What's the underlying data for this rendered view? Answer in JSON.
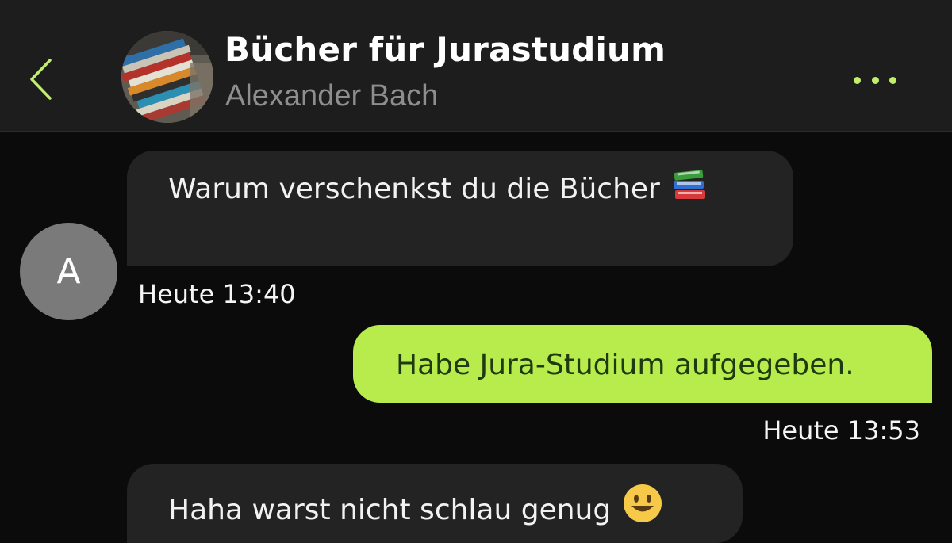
{
  "header": {
    "title": "Bücher für Jurastudium",
    "subtitle": "Alexander Bach",
    "back_icon": "chevron-left-icon",
    "more_icon": "more-dots-icon",
    "accent_color": "#c1ef6b"
  },
  "sender": {
    "initial": "A"
  },
  "messages": [
    {
      "direction": "incoming",
      "text": "Warum verschenkst du die Bücher",
      "emoji": "books-emoji",
      "time": "Heute 13:40"
    },
    {
      "direction": "outgoing",
      "text": "Habe Jura-Studium aufgegeben.",
      "time": "Heute 13:53"
    },
    {
      "direction": "incoming",
      "text": "Haha warst nicht schlau genug",
      "emoji": "grinning-face-emoji"
    }
  ],
  "colors": {
    "header_bg": "#1d1d1d",
    "page_bg": "#0b0b0b",
    "incoming_bubble": "#232323",
    "outgoing_bubble": "#b8ec4c",
    "outgoing_text": "#1f3a10"
  }
}
